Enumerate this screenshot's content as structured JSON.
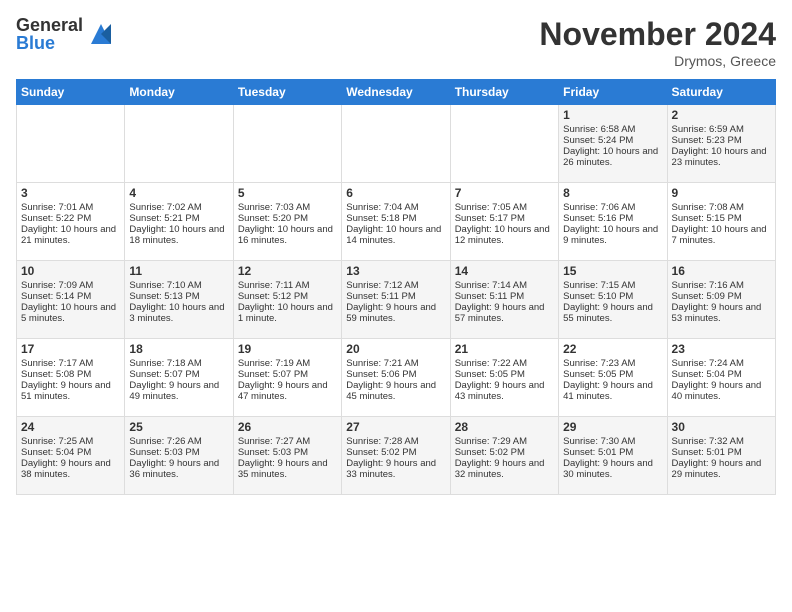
{
  "logo": {
    "general": "General",
    "blue": "Blue"
  },
  "header": {
    "month": "November 2024",
    "location": "Drymos, Greece"
  },
  "days_of_week": [
    "Sunday",
    "Monday",
    "Tuesday",
    "Wednesday",
    "Thursday",
    "Friday",
    "Saturday"
  ],
  "weeks": [
    [
      {
        "day": "",
        "content": ""
      },
      {
        "day": "",
        "content": ""
      },
      {
        "day": "",
        "content": ""
      },
      {
        "day": "",
        "content": ""
      },
      {
        "day": "",
        "content": ""
      },
      {
        "day": "1",
        "content": "Sunrise: 6:58 AM\nSunset: 5:24 PM\nDaylight: 10 hours and 26 minutes."
      },
      {
        "day": "2",
        "content": "Sunrise: 6:59 AM\nSunset: 5:23 PM\nDaylight: 10 hours and 23 minutes."
      }
    ],
    [
      {
        "day": "3",
        "content": "Sunrise: 7:01 AM\nSunset: 5:22 PM\nDaylight: 10 hours and 21 minutes."
      },
      {
        "day": "4",
        "content": "Sunrise: 7:02 AM\nSunset: 5:21 PM\nDaylight: 10 hours and 18 minutes."
      },
      {
        "day": "5",
        "content": "Sunrise: 7:03 AM\nSunset: 5:20 PM\nDaylight: 10 hours and 16 minutes."
      },
      {
        "day": "6",
        "content": "Sunrise: 7:04 AM\nSunset: 5:18 PM\nDaylight: 10 hours and 14 minutes."
      },
      {
        "day": "7",
        "content": "Sunrise: 7:05 AM\nSunset: 5:17 PM\nDaylight: 10 hours and 12 minutes."
      },
      {
        "day": "8",
        "content": "Sunrise: 7:06 AM\nSunset: 5:16 PM\nDaylight: 10 hours and 9 minutes."
      },
      {
        "day": "9",
        "content": "Sunrise: 7:08 AM\nSunset: 5:15 PM\nDaylight: 10 hours and 7 minutes."
      }
    ],
    [
      {
        "day": "10",
        "content": "Sunrise: 7:09 AM\nSunset: 5:14 PM\nDaylight: 10 hours and 5 minutes."
      },
      {
        "day": "11",
        "content": "Sunrise: 7:10 AM\nSunset: 5:13 PM\nDaylight: 10 hours and 3 minutes."
      },
      {
        "day": "12",
        "content": "Sunrise: 7:11 AM\nSunset: 5:12 PM\nDaylight: 10 hours and 1 minute."
      },
      {
        "day": "13",
        "content": "Sunrise: 7:12 AM\nSunset: 5:11 PM\nDaylight: 9 hours and 59 minutes."
      },
      {
        "day": "14",
        "content": "Sunrise: 7:14 AM\nSunset: 5:11 PM\nDaylight: 9 hours and 57 minutes."
      },
      {
        "day": "15",
        "content": "Sunrise: 7:15 AM\nSunset: 5:10 PM\nDaylight: 9 hours and 55 minutes."
      },
      {
        "day": "16",
        "content": "Sunrise: 7:16 AM\nSunset: 5:09 PM\nDaylight: 9 hours and 53 minutes."
      }
    ],
    [
      {
        "day": "17",
        "content": "Sunrise: 7:17 AM\nSunset: 5:08 PM\nDaylight: 9 hours and 51 minutes."
      },
      {
        "day": "18",
        "content": "Sunrise: 7:18 AM\nSunset: 5:07 PM\nDaylight: 9 hours and 49 minutes."
      },
      {
        "day": "19",
        "content": "Sunrise: 7:19 AM\nSunset: 5:07 PM\nDaylight: 9 hours and 47 minutes."
      },
      {
        "day": "20",
        "content": "Sunrise: 7:21 AM\nSunset: 5:06 PM\nDaylight: 9 hours and 45 minutes."
      },
      {
        "day": "21",
        "content": "Sunrise: 7:22 AM\nSunset: 5:05 PM\nDaylight: 9 hours and 43 minutes."
      },
      {
        "day": "22",
        "content": "Sunrise: 7:23 AM\nSunset: 5:05 PM\nDaylight: 9 hours and 41 minutes."
      },
      {
        "day": "23",
        "content": "Sunrise: 7:24 AM\nSunset: 5:04 PM\nDaylight: 9 hours and 40 minutes."
      }
    ],
    [
      {
        "day": "24",
        "content": "Sunrise: 7:25 AM\nSunset: 5:04 PM\nDaylight: 9 hours and 38 minutes."
      },
      {
        "day": "25",
        "content": "Sunrise: 7:26 AM\nSunset: 5:03 PM\nDaylight: 9 hours and 36 minutes."
      },
      {
        "day": "26",
        "content": "Sunrise: 7:27 AM\nSunset: 5:03 PM\nDaylight: 9 hours and 35 minutes."
      },
      {
        "day": "27",
        "content": "Sunrise: 7:28 AM\nSunset: 5:02 PM\nDaylight: 9 hours and 33 minutes."
      },
      {
        "day": "28",
        "content": "Sunrise: 7:29 AM\nSunset: 5:02 PM\nDaylight: 9 hours and 32 minutes."
      },
      {
        "day": "29",
        "content": "Sunrise: 7:30 AM\nSunset: 5:01 PM\nDaylight: 9 hours and 30 minutes."
      },
      {
        "day": "30",
        "content": "Sunrise: 7:32 AM\nSunset: 5:01 PM\nDaylight: 9 hours and 29 minutes."
      }
    ]
  ]
}
